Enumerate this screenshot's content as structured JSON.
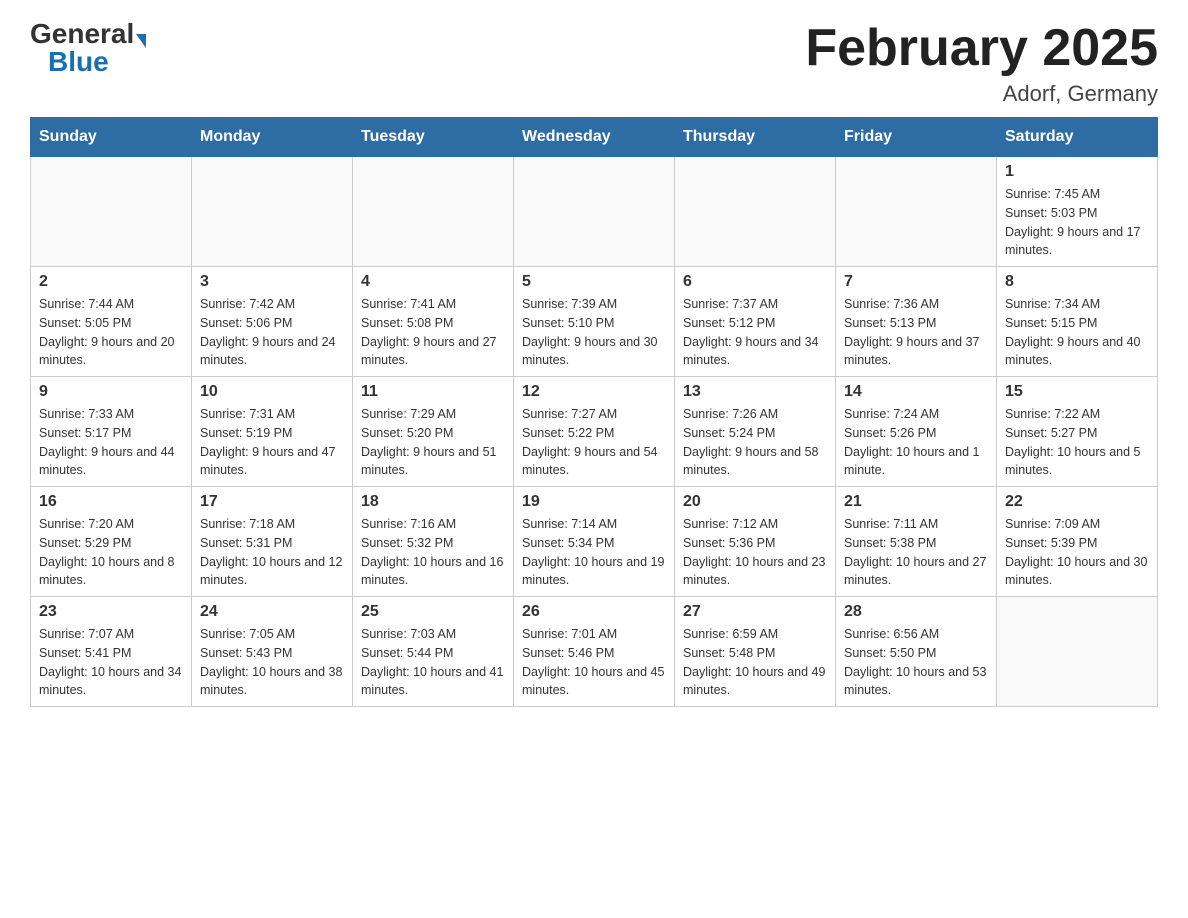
{
  "header": {
    "logo_general": "General",
    "logo_blue": "Blue",
    "month_title": "February 2025",
    "location": "Adorf, Germany"
  },
  "days_of_week": [
    "Sunday",
    "Monday",
    "Tuesday",
    "Wednesday",
    "Thursday",
    "Friday",
    "Saturday"
  ],
  "weeks": [
    [
      {
        "day": "",
        "info": ""
      },
      {
        "day": "",
        "info": ""
      },
      {
        "day": "",
        "info": ""
      },
      {
        "day": "",
        "info": ""
      },
      {
        "day": "",
        "info": ""
      },
      {
        "day": "",
        "info": ""
      },
      {
        "day": "1",
        "info": "Sunrise: 7:45 AM\nSunset: 5:03 PM\nDaylight: 9 hours and 17 minutes."
      }
    ],
    [
      {
        "day": "2",
        "info": "Sunrise: 7:44 AM\nSunset: 5:05 PM\nDaylight: 9 hours and 20 minutes."
      },
      {
        "day": "3",
        "info": "Sunrise: 7:42 AM\nSunset: 5:06 PM\nDaylight: 9 hours and 24 minutes."
      },
      {
        "day": "4",
        "info": "Sunrise: 7:41 AM\nSunset: 5:08 PM\nDaylight: 9 hours and 27 minutes."
      },
      {
        "day": "5",
        "info": "Sunrise: 7:39 AM\nSunset: 5:10 PM\nDaylight: 9 hours and 30 minutes."
      },
      {
        "day": "6",
        "info": "Sunrise: 7:37 AM\nSunset: 5:12 PM\nDaylight: 9 hours and 34 minutes."
      },
      {
        "day": "7",
        "info": "Sunrise: 7:36 AM\nSunset: 5:13 PM\nDaylight: 9 hours and 37 minutes."
      },
      {
        "day": "8",
        "info": "Sunrise: 7:34 AM\nSunset: 5:15 PM\nDaylight: 9 hours and 40 minutes."
      }
    ],
    [
      {
        "day": "9",
        "info": "Sunrise: 7:33 AM\nSunset: 5:17 PM\nDaylight: 9 hours and 44 minutes."
      },
      {
        "day": "10",
        "info": "Sunrise: 7:31 AM\nSunset: 5:19 PM\nDaylight: 9 hours and 47 minutes."
      },
      {
        "day": "11",
        "info": "Sunrise: 7:29 AM\nSunset: 5:20 PM\nDaylight: 9 hours and 51 minutes."
      },
      {
        "day": "12",
        "info": "Sunrise: 7:27 AM\nSunset: 5:22 PM\nDaylight: 9 hours and 54 minutes."
      },
      {
        "day": "13",
        "info": "Sunrise: 7:26 AM\nSunset: 5:24 PM\nDaylight: 9 hours and 58 minutes."
      },
      {
        "day": "14",
        "info": "Sunrise: 7:24 AM\nSunset: 5:26 PM\nDaylight: 10 hours and 1 minute."
      },
      {
        "day": "15",
        "info": "Sunrise: 7:22 AM\nSunset: 5:27 PM\nDaylight: 10 hours and 5 minutes."
      }
    ],
    [
      {
        "day": "16",
        "info": "Sunrise: 7:20 AM\nSunset: 5:29 PM\nDaylight: 10 hours and 8 minutes."
      },
      {
        "day": "17",
        "info": "Sunrise: 7:18 AM\nSunset: 5:31 PM\nDaylight: 10 hours and 12 minutes."
      },
      {
        "day": "18",
        "info": "Sunrise: 7:16 AM\nSunset: 5:32 PM\nDaylight: 10 hours and 16 minutes."
      },
      {
        "day": "19",
        "info": "Sunrise: 7:14 AM\nSunset: 5:34 PM\nDaylight: 10 hours and 19 minutes."
      },
      {
        "day": "20",
        "info": "Sunrise: 7:12 AM\nSunset: 5:36 PM\nDaylight: 10 hours and 23 minutes."
      },
      {
        "day": "21",
        "info": "Sunrise: 7:11 AM\nSunset: 5:38 PM\nDaylight: 10 hours and 27 minutes."
      },
      {
        "day": "22",
        "info": "Sunrise: 7:09 AM\nSunset: 5:39 PM\nDaylight: 10 hours and 30 minutes."
      }
    ],
    [
      {
        "day": "23",
        "info": "Sunrise: 7:07 AM\nSunset: 5:41 PM\nDaylight: 10 hours and 34 minutes."
      },
      {
        "day": "24",
        "info": "Sunrise: 7:05 AM\nSunset: 5:43 PM\nDaylight: 10 hours and 38 minutes."
      },
      {
        "day": "25",
        "info": "Sunrise: 7:03 AM\nSunset: 5:44 PM\nDaylight: 10 hours and 41 minutes."
      },
      {
        "day": "26",
        "info": "Sunrise: 7:01 AM\nSunset: 5:46 PM\nDaylight: 10 hours and 45 minutes."
      },
      {
        "day": "27",
        "info": "Sunrise: 6:59 AM\nSunset: 5:48 PM\nDaylight: 10 hours and 49 minutes."
      },
      {
        "day": "28",
        "info": "Sunrise: 6:56 AM\nSunset: 5:50 PM\nDaylight: 10 hours and 53 minutes."
      },
      {
        "day": "",
        "info": ""
      }
    ]
  ]
}
